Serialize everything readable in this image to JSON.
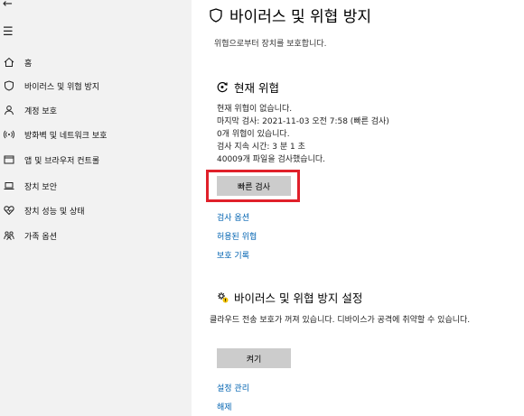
{
  "sidebar": {
    "back_icon": "←",
    "menu_icon": "☰",
    "items": [
      {
        "label": "홈",
        "icon": "home-icon"
      },
      {
        "label": "바이러스 및 위협 방지",
        "icon": "shield-icon"
      },
      {
        "label": "계정 보호",
        "icon": "person-icon"
      },
      {
        "label": "방화벽 및 네트워크 보호",
        "icon": "wireless-icon"
      },
      {
        "label": "앱 및 브라우저 컨트롤",
        "icon": "app-window-icon"
      },
      {
        "label": "장치 보안",
        "icon": "laptop-icon"
      },
      {
        "label": "장치 성능 및 상태",
        "icon": "heart-icon"
      },
      {
        "label": "가족 옵션",
        "icon": "family-icon"
      }
    ]
  },
  "main": {
    "title": "바이러스 및 위협 방지",
    "subtitle": "위협으로부터 장치를 보호합니다.",
    "current_threats": {
      "title": "현재 위협",
      "lines": [
        "현재 위협이 없습니다.",
        "마지막 검사: 2021-11-03 오전 7:58 (빠른 검사)",
        "0개 위협이 있습니다.",
        "검사 지속 시간: 3 분 1 초",
        "40009개 파일을 검사했습니다."
      ],
      "quick_scan_button": "빠른 검사",
      "links": [
        "검사 옵션",
        "허용된 위협",
        "보호 기록"
      ]
    },
    "settings": {
      "title": "바이러스 및 위협 방지 설정",
      "text": "클라우드 전송 보호가 꺼져 있습니다. 디바이스가 공격에 취약할 수 있습니다.",
      "turn_on_button": "켜기",
      "links": [
        "설정 관리",
        "해제"
      ]
    }
  },
  "colors": {
    "link": "#0063b1",
    "highlight": "#e0202a",
    "sidebar_bg": "#f2f2f2",
    "button_bg": "#cccccc"
  }
}
